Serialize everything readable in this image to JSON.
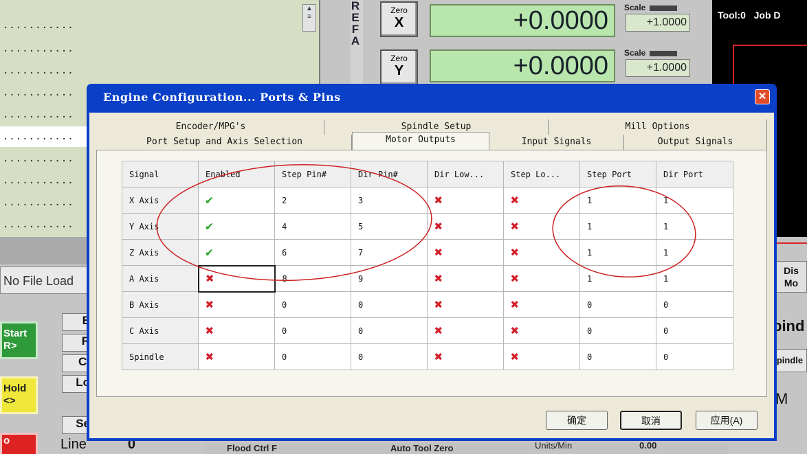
{
  "background": {
    "gcode_lines": [
      "...........",
      "...........",
      "...........",
      "...........",
      "...........",
      "...........",
      "...........",
      "...........",
      "...........",
      "..........."
    ],
    "status_text": "No File Load",
    "ref_strip": "REFA",
    "side_buttons": [
      "E",
      "R",
      "Cl",
      "Lo",
      "Se"
    ],
    "start_button": "Start\nR>",
    "hold_button": "Hold\n<>",
    "red_button": "o",
    "line_label": "Line",
    "line_value": "0",
    "zero_x": {
      "small": "Zero",
      "axis": "X"
    },
    "zero_y": {
      "small": "Zero",
      "axis": "Y"
    },
    "dro_x": "+0.0000",
    "dro_y": "+0.0000",
    "scale_label": "Scale",
    "scale_x": "+1.0000",
    "scale_y": "+1.0000",
    "tool_pane_text": "Tool:0   Job D",
    "display_mode": "Dis\nMo",
    "spindle_label": "pind",
    "spindle_button": "pindle",
    "m_label": "M",
    "bottom_labels": [
      "Flood Ctrl F",
      "Auto Tool Zero",
      "Units/Min",
      "0.00"
    ]
  },
  "dialog": {
    "title": "Engine Configuration... Ports & Pins",
    "close_glyph": "✕",
    "tabs_row1": [
      "Encoder/MPG's",
      "Spindle Setup",
      "Mill Options"
    ],
    "tabs_row2": [
      "Port Setup and Axis Selection",
      "Motor Outputs",
      "Input Signals",
      "Output Signals"
    ],
    "active_tab": "Motor Outputs",
    "columns": [
      "Signal",
      "Enabled",
      "Step Pin#",
      "Dir Pin#",
      "Dir Low...",
      "Step Lo...",
      "Step Port",
      "Dir Port"
    ],
    "rows": [
      {
        "signal": "X Axis",
        "enabled": true,
        "step_pin": "2",
        "dir_pin": "3",
        "dir_low": false,
        "step_low": false,
        "step_port": "1",
        "dir_port": "1"
      },
      {
        "signal": "Y Axis",
        "enabled": true,
        "step_pin": "4",
        "dir_pin": "5",
        "dir_low": false,
        "step_low": false,
        "step_port": "1",
        "dir_port": "1"
      },
      {
        "signal": "Z Axis",
        "enabled": true,
        "step_pin": "6",
        "dir_pin": "7",
        "dir_low": false,
        "step_low": false,
        "step_port": "1",
        "dir_port": "1"
      },
      {
        "signal": "A Axis",
        "enabled": false,
        "step_pin": "8",
        "dir_pin": "9",
        "dir_low": false,
        "step_low": false,
        "step_port": "1",
        "dir_port": "1"
      },
      {
        "signal": "B Axis",
        "enabled": false,
        "step_pin": "0",
        "dir_pin": "0",
        "dir_low": false,
        "step_low": false,
        "step_port": "0",
        "dir_port": "0"
      },
      {
        "signal": "C Axis",
        "enabled": false,
        "step_pin": "0",
        "dir_pin": "0",
        "dir_low": false,
        "step_low": false,
        "step_port": "0",
        "dir_port": "0"
      },
      {
        "signal": "Spindle",
        "enabled": false,
        "step_pin": "0",
        "dir_pin": "0",
        "dir_low": false,
        "step_low": false,
        "step_port": "0",
        "dir_port": "0"
      }
    ],
    "buttons": {
      "ok": "确定",
      "cancel": "取消",
      "apply": "应用(A)"
    },
    "check_glyph": "✔",
    "cross_glyph": "✖",
    "colors": {
      "titlebar": "#0a3fc8",
      "check": "#2ca62c",
      "cross": "#d21f2a",
      "annotation": "#cc2222"
    }
  }
}
